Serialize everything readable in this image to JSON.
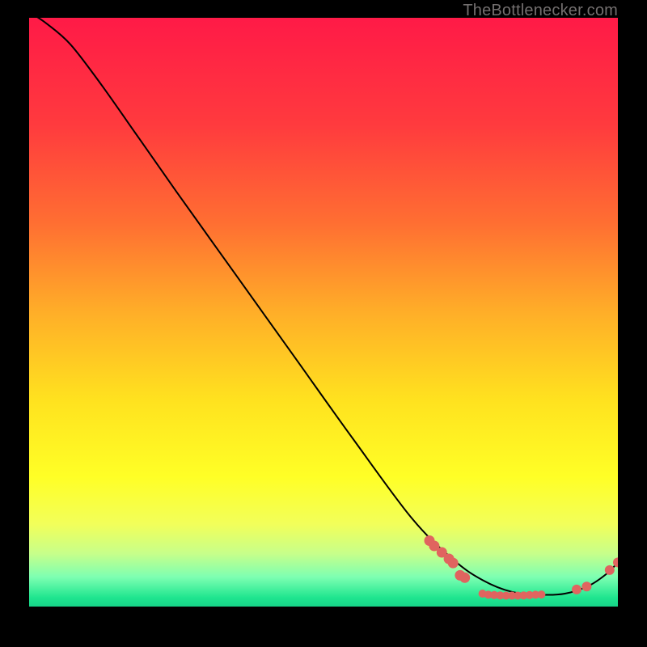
{
  "watermark": "TheBottlenecker.com",
  "colors": {
    "curve": "#000000",
    "marker": "#e0645f",
    "bg_black": "#000000"
  },
  "chart_data": {
    "type": "line",
    "title": "",
    "xlabel": "",
    "ylabel": "",
    "xlim": [
      0,
      100
    ],
    "ylim": [
      0,
      100
    ],
    "gradient_stops": [
      {
        "offset": 0.0,
        "color": "#ff1a47"
      },
      {
        "offset": 0.18,
        "color": "#ff3a3e"
      },
      {
        "offset": 0.35,
        "color": "#ff6f32"
      },
      {
        "offset": 0.5,
        "color": "#ffae28"
      },
      {
        "offset": 0.65,
        "color": "#ffe21f"
      },
      {
        "offset": 0.78,
        "color": "#ffff26"
      },
      {
        "offset": 0.86,
        "color": "#f2ff5a"
      },
      {
        "offset": 0.91,
        "color": "#c7ff8a"
      },
      {
        "offset": 0.95,
        "color": "#7dffb2"
      },
      {
        "offset": 0.985,
        "color": "#1fe58f"
      },
      {
        "offset": 1.0,
        "color": "#16d488"
      }
    ],
    "curve": [
      {
        "x": 0.0,
        "y": 101.0
      },
      {
        "x": 3.0,
        "y": 99.0
      },
      {
        "x": 7.0,
        "y": 95.5
      },
      {
        "x": 12.0,
        "y": 89.0
      },
      {
        "x": 18.0,
        "y": 80.5
      },
      {
        "x": 25.0,
        "y": 70.5
      },
      {
        "x": 35.0,
        "y": 56.5
      },
      {
        "x": 45.0,
        "y": 42.5
      },
      {
        "x": 55.0,
        "y": 28.5
      },
      {
        "x": 65.0,
        "y": 15.0
      },
      {
        "x": 72.0,
        "y": 8.0
      },
      {
        "x": 77.0,
        "y": 4.5
      },
      {
        "x": 82.0,
        "y": 2.5
      },
      {
        "x": 87.0,
        "y": 2.0
      },
      {
        "x": 91.0,
        "y": 2.2
      },
      {
        "x": 95.0,
        "y": 3.5
      },
      {
        "x": 98.0,
        "y": 5.5
      },
      {
        "x": 100.0,
        "y": 7.5
      }
    ],
    "markers_cluster_a": [
      {
        "x": 68.0,
        "y": 11.2
      },
      {
        "x": 68.8,
        "y": 10.3
      },
      {
        "x": 70.1,
        "y": 9.2
      },
      {
        "x": 71.3,
        "y": 8.1
      },
      {
        "x": 72.0,
        "y": 7.4
      },
      {
        "x": 73.2,
        "y": 5.3
      },
      {
        "x": 74.0,
        "y": 4.9
      }
    ],
    "markers_cluster_b": [
      {
        "x": 77.0,
        "y": 2.2
      },
      {
        "x": 78.0,
        "y": 2.0
      },
      {
        "x": 79.0,
        "y": 1.95
      },
      {
        "x": 80.0,
        "y": 1.9
      },
      {
        "x": 81.0,
        "y": 1.85
      },
      {
        "x": 82.0,
        "y": 1.85
      },
      {
        "x": 83.0,
        "y": 1.85
      },
      {
        "x": 84.0,
        "y": 1.9
      },
      {
        "x": 85.0,
        "y": 1.95
      },
      {
        "x": 86.0,
        "y": 2.0
      },
      {
        "x": 87.0,
        "y": 2.05
      }
    ],
    "markers_cluster_c": [
      {
        "x": 93.0,
        "y": 2.9
      },
      {
        "x": 94.7,
        "y": 3.4
      }
    ],
    "markers_cluster_d": [
      {
        "x": 98.6,
        "y": 6.2
      },
      {
        "x": 100.0,
        "y": 7.5
      }
    ]
  }
}
